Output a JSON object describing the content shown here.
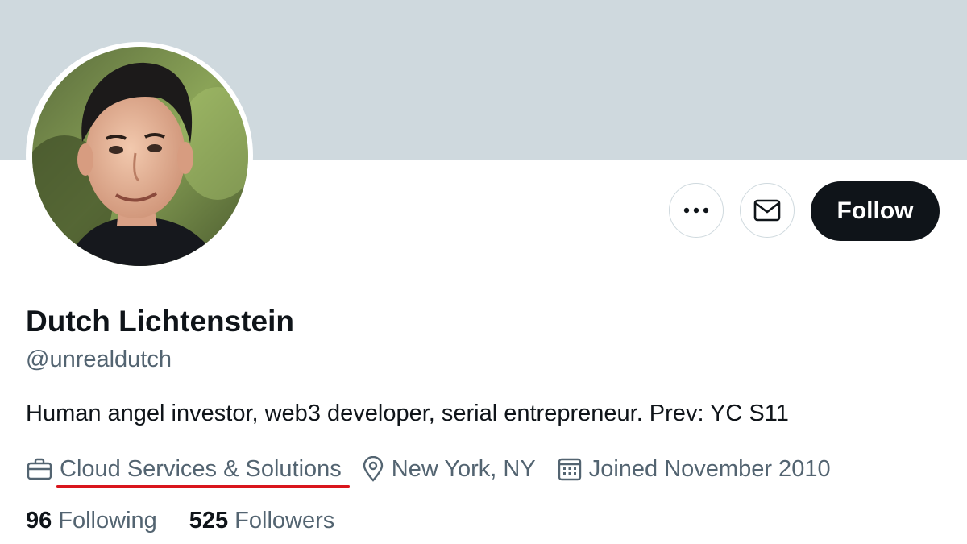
{
  "profile": {
    "display_name": "Dutch Lichtenstein",
    "handle": "@unrealdutch",
    "bio": "Human angel investor, web3 developer, serial entrepreneur. Prev: YC S11",
    "company": "Cloud Services & Solutions",
    "location": "New York, NY",
    "joined": "Joined November 2010",
    "following_count": "96",
    "following_label": "Following",
    "followers_count": "525",
    "followers_label": "Followers"
  },
  "actions": {
    "follow_label": "Follow",
    "more_icon": "more-icon",
    "message_icon": "envelope-icon"
  },
  "icons": {
    "company": "briefcase-icon",
    "location": "location-pin-icon",
    "joined": "calendar-icon"
  },
  "colors": {
    "banner": "#cfd9de",
    "text_primary": "#0f1419",
    "text_secondary": "#536471",
    "follow_button_bg": "#0f1419",
    "annotation_underline": "#d9151c"
  }
}
